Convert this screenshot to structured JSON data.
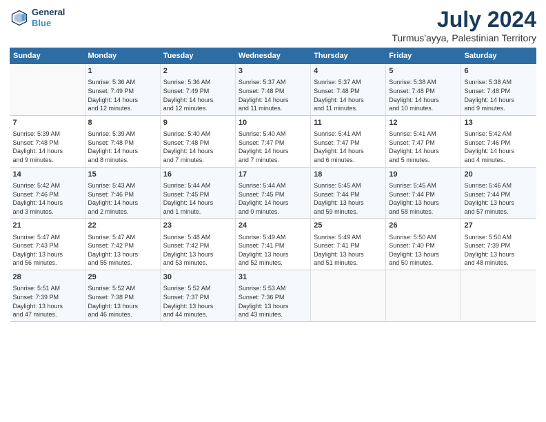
{
  "header": {
    "logo_line1": "General",
    "logo_line2": "Blue",
    "main_title": "July 2024",
    "subtitle": "Turmus'ayya, Palestinian Territory"
  },
  "days_of_week": [
    "Sunday",
    "Monday",
    "Tuesday",
    "Wednesday",
    "Thursday",
    "Friday",
    "Saturday"
  ],
  "weeks": [
    [
      {
        "day": "",
        "content": ""
      },
      {
        "day": "1",
        "content": "Sunrise: 5:36 AM\nSunset: 7:49 PM\nDaylight: 14 hours\nand 12 minutes."
      },
      {
        "day": "2",
        "content": "Sunrise: 5:36 AM\nSunset: 7:49 PM\nDaylight: 14 hours\nand 12 minutes."
      },
      {
        "day": "3",
        "content": "Sunrise: 5:37 AM\nSunset: 7:48 PM\nDaylight: 14 hours\nand 11 minutes."
      },
      {
        "day": "4",
        "content": "Sunrise: 5:37 AM\nSunset: 7:48 PM\nDaylight: 14 hours\nand 11 minutes."
      },
      {
        "day": "5",
        "content": "Sunrise: 5:38 AM\nSunset: 7:48 PM\nDaylight: 14 hours\nand 10 minutes."
      },
      {
        "day": "6",
        "content": "Sunrise: 5:38 AM\nSunset: 7:48 PM\nDaylight: 14 hours\nand 9 minutes."
      }
    ],
    [
      {
        "day": "7",
        "content": "Sunrise: 5:39 AM\nSunset: 7:48 PM\nDaylight: 14 hours\nand 9 minutes."
      },
      {
        "day": "8",
        "content": "Sunrise: 5:39 AM\nSunset: 7:48 PM\nDaylight: 14 hours\nand 8 minutes."
      },
      {
        "day": "9",
        "content": "Sunrise: 5:40 AM\nSunset: 7:48 PM\nDaylight: 14 hours\nand 7 minutes."
      },
      {
        "day": "10",
        "content": "Sunrise: 5:40 AM\nSunset: 7:47 PM\nDaylight: 14 hours\nand 7 minutes."
      },
      {
        "day": "11",
        "content": "Sunrise: 5:41 AM\nSunset: 7:47 PM\nDaylight: 14 hours\nand 6 minutes."
      },
      {
        "day": "12",
        "content": "Sunrise: 5:41 AM\nSunset: 7:47 PM\nDaylight: 14 hours\nand 5 minutes."
      },
      {
        "day": "13",
        "content": "Sunrise: 5:42 AM\nSunset: 7:46 PM\nDaylight: 14 hours\nand 4 minutes."
      }
    ],
    [
      {
        "day": "14",
        "content": "Sunrise: 5:42 AM\nSunset: 7:46 PM\nDaylight: 14 hours\nand 3 minutes."
      },
      {
        "day": "15",
        "content": "Sunrise: 5:43 AM\nSunset: 7:46 PM\nDaylight: 14 hours\nand 2 minutes."
      },
      {
        "day": "16",
        "content": "Sunrise: 5:44 AM\nSunset: 7:45 PM\nDaylight: 14 hours\nand 1 minute."
      },
      {
        "day": "17",
        "content": "Sunrise: 5:44 AM\nSunset: 7:45 PM\nDaylight: 14 hours\nand 0 minutes."
      },
      {
        "day": "18",
        "content": "Sunrise: 5:45 AM\nSunset: 7:44 PM\nDaylight: 13 hours\nand 59 minutes."
      },
      {
        "day": "19",
        "content": "Sunrise: 5:45 AM\nSunset: 7:44 PM\nDaylight: 13 hours\nand 58 minutes."
      },
      {
        "day": "20",
        "content": "Sunrise: 5:46 AM\nSunset: 7:44 PM\nDaylight: 13 hours\nand 57 minutes."
      }
    ],
    [
      {
        "day": "21",
        "content": "Sunrise: 5:47 AM\nSunset: 7:43 PM\nDaylight: 13 hours\nand 56 minutes."
      },
      {
        "day": "22",
        "content": "Sunrise: 5:47 AM\nSunset: 7:42 PM\nDaylight: 13 hours\nand 55 minutes."
      },
      {
        "day": "23",
        "content": "Sunrise: 5:48 AM\nSunset: 7:42 PM\nDaylight: 13 hours\nand 53 minutes."
      },
      {
        "day": "24",
        "content": "Sunrise: 5:49 AM\nSunset: 7:41 PM\nDaylight: 13 hours\nand 52 minutes."
      },
      {
        "day": "25",
        "content": "Sunrise: 5:49 AM\nSunset: 7:41 PM\nDaylight: 13 hours\nand 51 minutes."
      },
      {
        "day": "26",
        "content": "Sunrise: 5:50 AM\nSunset: 7:40 PM\nDaylight: 13 hours\nand 50 minutes."
      },
      {
        "day": "27",
        "content": "Sunrise: 5:50 AM\nSunset: 7:39 PM\nDaylight: 13 hours\nand 48 minutes."
      }
    ],
    [
      {
        "day": "28",
        "content": "Sunrise: 5:51 AM\nSunset: 7:39 PM\nDaylight: 13 hours\nand 47 minutes."
      },
      {
        "day": "29",
        "content": "Sunrise: 5:52 AM\nSunset: 7:38 PM\nDaylight: 13 hours\nand 46 minutes."
      },
      {
        "day": "30",
        "content": "Sunrise: 5:52 AM\nSunset: 7:37 PM\nDaylight: 13 hours\nand 44 minutes."
      },
      {
        "day": "31",
        "content": "Sunrise: 5:53 AM\nSunset: 7:36 PM\nDaylight: 13 hours\nand 43 minutes."
      },
      {
        "day": "",
        "content": ""
      },
      {
        "day": "",
        "content": ""
      },
      {
        "day": "",
        "content": ""
      }
    ]
  ]
}
